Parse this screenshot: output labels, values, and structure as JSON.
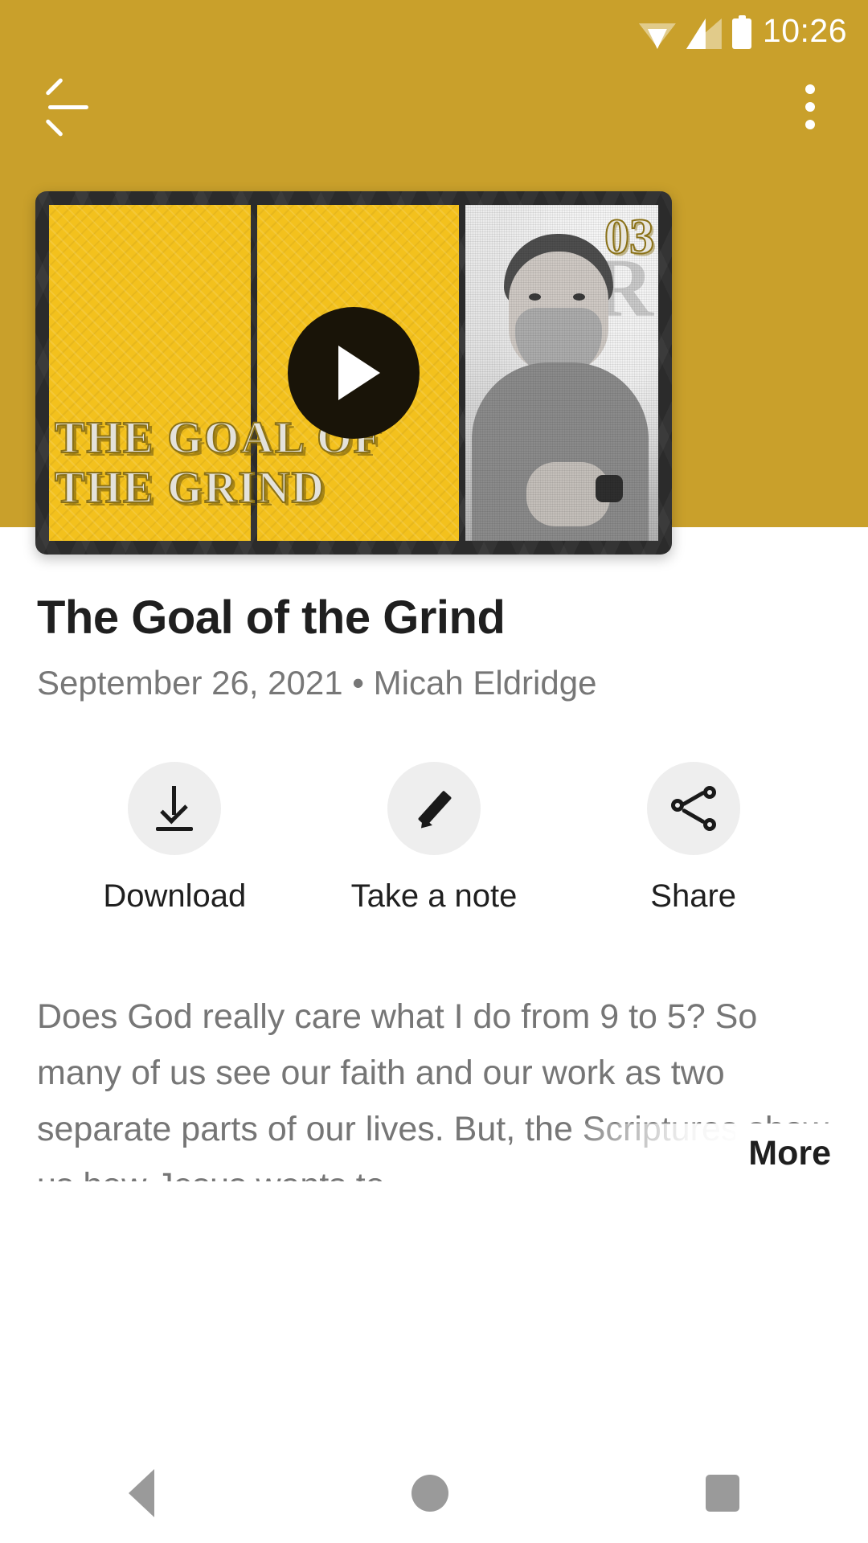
{
  "status_bar": {
    "time": "10:26",
    "icons": [
      "wifi-icon",
      "signal-icon",
      "battery-icon"
    ]
  },
  "app_bar": {
    "back_icon": "back-arrow-icon",
    "overflow_icon": "more-vertical-icon"
  },
  "video": {
    "episode_number": "03",
    "artwork_title_line1": "THE GOAL OF",
    "artwork_title_line2": "THE GRIND",
    "play_icon": "play-icon"
  },
  "detail": {
    "title": "The Goal of the Grind",
    "meta": "September 26, 2021 • Micah Eldridge"
  },
  "actions": [
    {
      "icon": "download-icon",
      "label": "Download"
    },
    {
      "icon": "pencil-icon",
      "label": "Take a note"
    },
    {
      "icon": "share-icon",
      "label": "Share"
    }
  ],
  "description": {
    "text": "Does God really care what I do from 9 to 5? So many of us see our faith and our work as two separate parts of our lives. But, the Scriptures show us how Jesus wants to",
    "more_label": "More"
  },
  "nav_bar": {
    "back": "nav-back-icon",
    "home": "nav-home-icon",
    "recents": "nav-recents-icon"
  },
  "colors": {
    "header_gold": "#c9a02b",
    "artwork_yellow": "#f3c11d",
    "frame_dark": "#2b2b2b",
    "title_text": "#1f1f1f",
    "muted_text": "#767676",
    "action_circle": "#eeeeee",
    "nav_icon": "#9a9a9a"
  }
}
